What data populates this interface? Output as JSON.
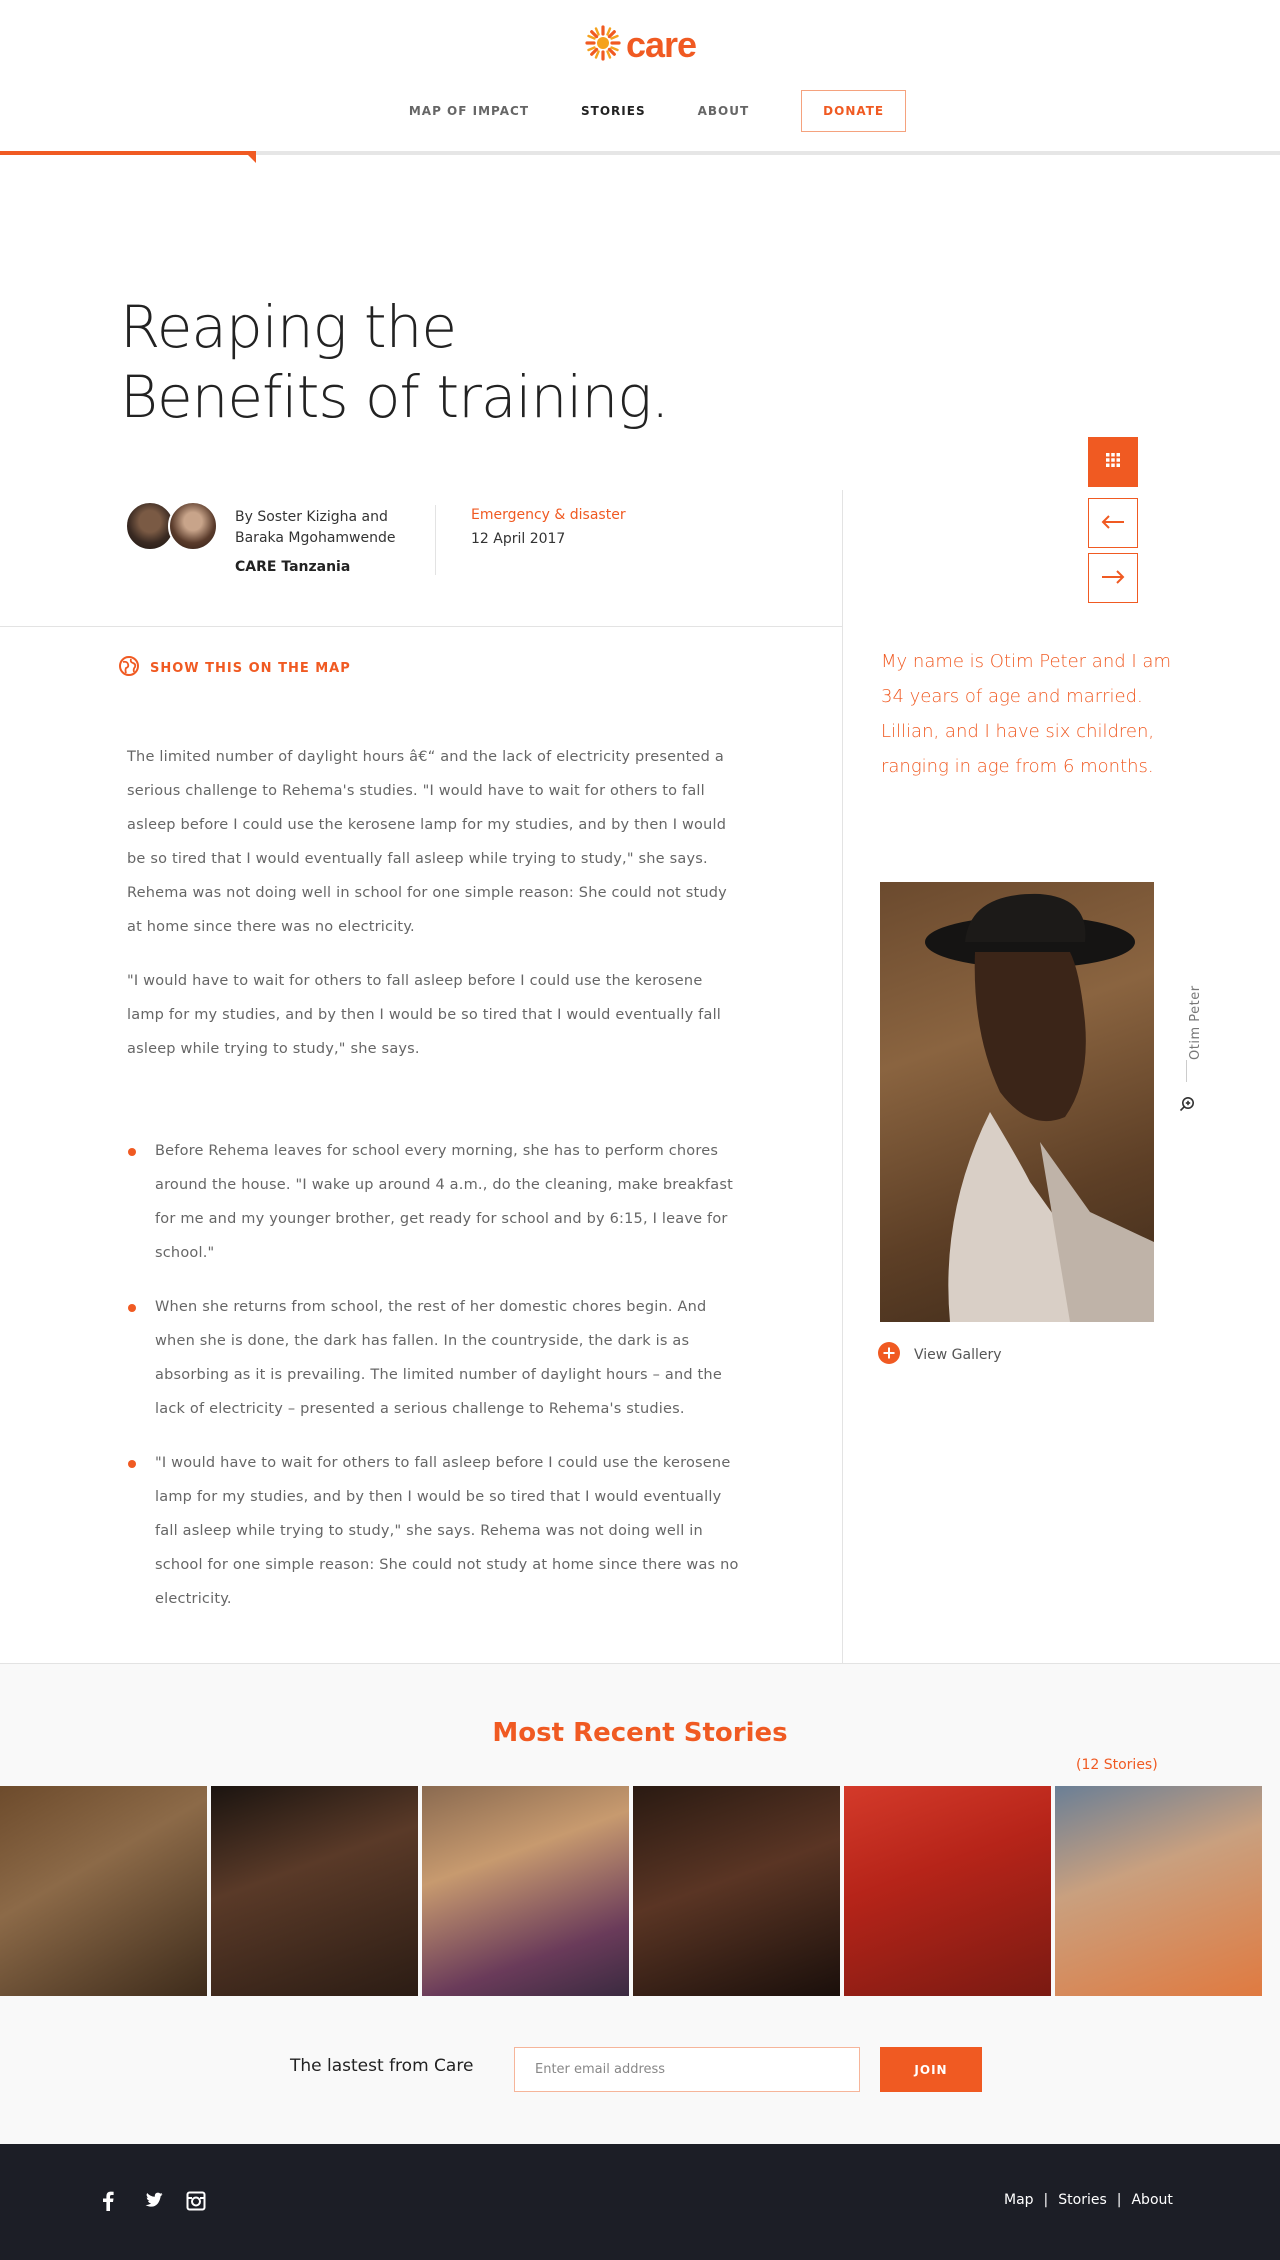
{
  "header": {
    "logo_text": "care",
    "nav": [
      {
        "label": "MAP OF IMPACT"
      },
      {
        "label": "STORIES"
      },
      {
        "label": "ABOUT"
      }
    ],
    "donate_label": "DONATE",
    "progress_fraction": 0.2,
    "brand_color": "#f05a22"
  },
  "article": {
    "title_line1": "Reaping the",
    "title_line2": "Benefits of training.",
    "byline": "By Soster Kizigha and Baraka Mgohamwende",
    "organization": "CARE Tanzania",
    "category": "Emergency & disaster",
    "date": "12 April 2017",
    "show_map_label": "SHOW THIS ON THE MAP",
    "paragraphs": [
      "The limited number of daylight hours â€“ and the lack of electricity presented a serious challenge to Rehema's studies. \"I would have to wait for others to fall asleep before I could use the kerosene lamp for my studies, and by then I would be so tired that I would eventually fall asleep while trying to study,\" she says. Rehema was not doing well in school for one simple reason: She could not study at home since there was no electricity.",
      "\"I would have to wait for others to fall asleep before I could use the kerosene lamp for my studies, and by then I would be so tired that I would eventually fall asleep while trying to study,\" she says."
    ],
    "bullets": [
      "Before Rehema leaves for school every morning, she has to perform chores around the house. \"I wake up around 4 a.m., do the cleaning, make breakfast for me and my younger brother, get ready for school and by 6:15, I leave for school.\"",
      "When she returns from school, the rest of her domestic chores begin. And when she is done, the dark has fallen. In the countryside, the dark is as absorbing as it is prevailing. The limited number of daylight hours – and the lack of electricity – presented a serious challenge to Rehema's studies.",
      "\"I would have to wait for others to fall asleep before I could use the kerosene lamp for my studies, and by then I would be so tired that I would eventually fall asleep while trying to study,\" she says. Rehema was not doing well in school for one simple reason: She could not study at home since there was no electricity."
    ]
  },
  "sidebar": {
    "quote": "My name is Otim Peter and I am 34 years of age and married. Lillian, and I have six children, ranging in age from 6 months.",
    "photo_caption": "Otim Peter",
    "view_gallery_label": "View Gallery"
  },
  "recent": {
    "title": "Most Recent Stories",
    "count_label": "(12 Stories)"
  },
  "newsletter": {
    "label": "The lastest from Care",
    "placeholder": "Enter email address",
    "join_label": "JOIN"
  },
  "footer": {
    "links": [
      {
        "label": "Map"
      },
      {
        "label": "Stories"
      },
      {
        "label": "About"
      }
    ],
    "separator": "|"
  }
}
